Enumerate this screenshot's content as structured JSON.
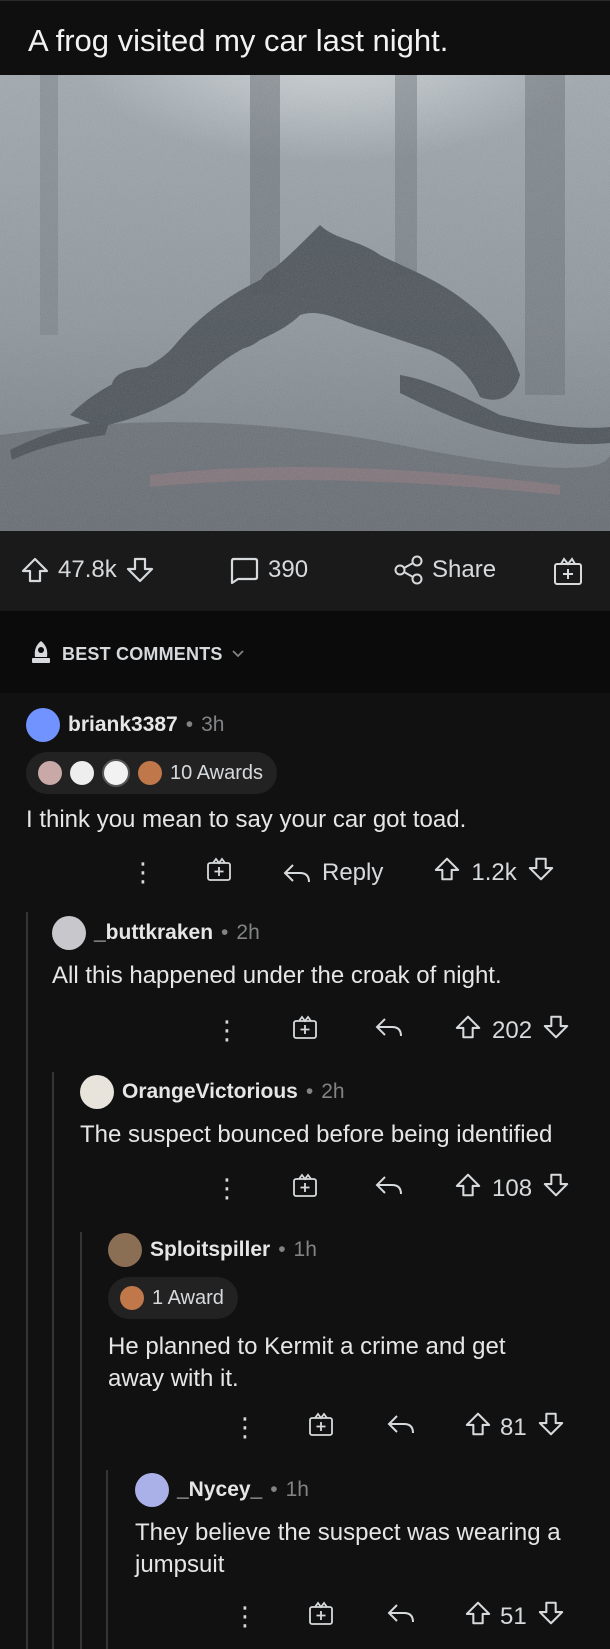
{
  "post": {
    "title": "A frog visited my car last night.",
    "upvotes": "47.8k",
    "comments_count": "390",
    "share_label": "Share"
  },
  "sort": {
    "label": "BEST COMMENTS"
  },
  "comments": [
    {
      "user": "briank3387",
      "time": "3h",
      "awards": "10 Awards",
      "body": "I think you mean to say your car got toad.",
      "reply_label": "Reply",
      "score": "1.2k"
    },
    {
      "user": "_buttkraken",
      "time": "2h",
      "body": "All this happened under the croak of night.",
      "score": "202"
    },
    {
      "user": "OrangeVictorious",
      "time": "2h",
      "body": "The suspect bounced before being identified",
      "score": "108"
    },
    {
      "user": "Sploitspiller",
      "time": "1h",
      "awards": "1 Award",
      "body": "He planned to Kermit a crime and get away with it.",
      "score": "81"
    },
    {
      "user": "_Nycey_",
      "time": "1h",
      "body": "They believe the suspect was wearing a jumpsuit",
      "score": "51"
    }
  ],
  "separator": "•",
  "colors": {
    "background": "#111112",
    "action_bar": "#1a1a1b",
    "text": "#d7dadc",
    "meta": "#818384"
  }
}
